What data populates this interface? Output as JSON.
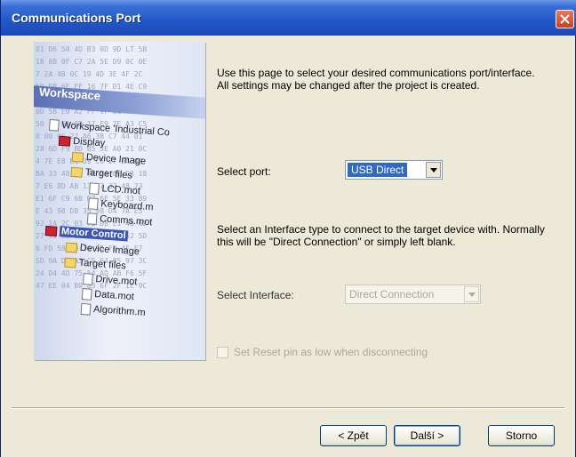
{
  "window": {
    "title": "Communications Port"
  },
  "illustration": {
    "workspace_label": "Workspace",
    "tree": [
      {
        "label": "Workspace 'Industrial Co",
        "icon": "workspace-icon",
        "level": 0
      },
      {
        "label": "Display",
        "icon": "chip-icon",
        "level": 1
      },
      {
        "label": "Device Image",
        "icon": "folder-icon",
        "level": 2
      },
      {
        "label": "Target files",
        "icon": "folder-icon",
        "level": 2
      },
      {
        "label": "LCD.mot",
        "icon": "file-icon",
        "level": 3
      },
      {
        "label": "Keyboard.m",
        "icon": "file-icon",
        "level": 3
      },
      {
        "label": "Comms.mot",
        "icon": "file-icon",
        "level": 3
      },
      {
        "label": "Motor Control",
        "icon": "chip-icon",
        "level": 1
      },
      {
        "label": "Device Image",
        "icon": "folder-icon",
        "level": 2
      },
      {
        "label": "Target files",
        "icon": "folder-icon",
        "level": 2
      },
      {
        "label": "Drive.mot",
        "icon": "file-icon",
        "level": 3
      },
      {
        "label": "Data.mot",
        "icon": "file-icon",
        "level": 3
      },
      {
        "label": "Algorithm.m",
        "icon": "file-icon",
        "level": 3
      }
    ]
  },
  "content": {
    "intro": "Use this page to select your desired communications port/interface. All settings may be changed after the project is created.",
    "port_label": "Select port:",
    "port_value": "USB Direct",
    "interface_help": "Select an Interface type to connect to the target device with. Normally this will be \"Direct Connection\" or simply left blank.",
    "interface_label": "Select Interface:",
    "interface_value": "Direct Connection",
    "reset_checkbox_label": "Set Reset pin as low when disconnecting"
  },
  "buttons": {
    "back": "< Zpět",
    "next": "Další >",
    "cancel": "Storno"
  },
  "colors": {
    "title_bar": "#2357c9",
    "selection": "#316ac5",
    "dialog_bg": "#ece9d8"
  }
}
